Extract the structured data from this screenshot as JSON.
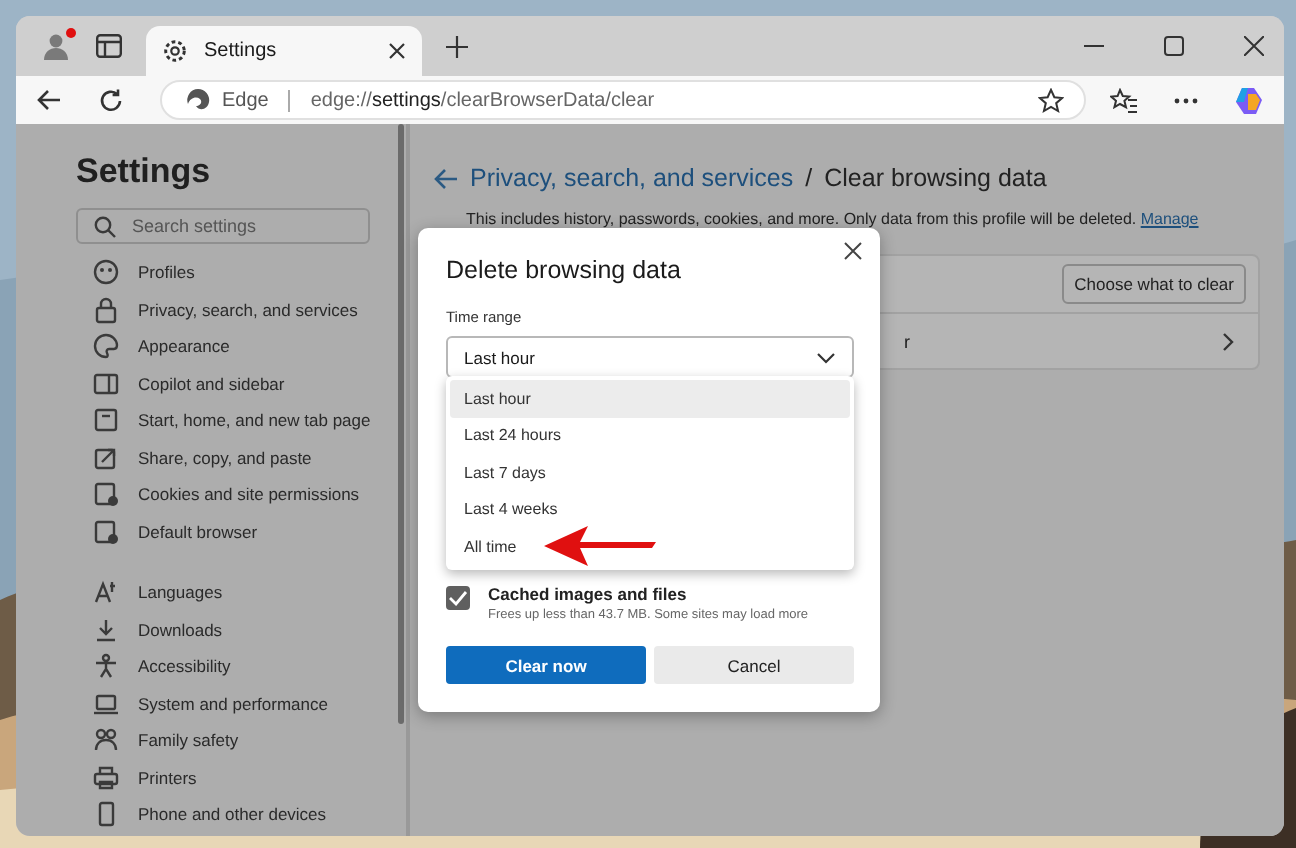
{
  "browser": {
    "tab": {
      "title": "Settings"
    },
    "address": {
      "site": "Edge",
      "url_prefix": "edge://",
      "url_bold": "settings",
      "url_rest": "/clearBrowserData/clear"
    },
    "profile_notification": true
  },
  "sidebar": {
    "title": "Settings",
    "search": {
      "placeholder": "Search settings"
    },
    "groups": [
      [
        {
          "label": "Profiles",
          "kind": "profile"
        },
        {
          "label": "Privacy, search, and services",
          "kind": "lock"
        },
        {
          "label": "Appearance",
          "kind": "palette"
        },
        {
          "label": "Copilot and sidebar",
          "kind": "sidebar"
        },
        {
          "label": "Start, home, and new tab page",
          "kind": "home"
        },
        {
          "label": "Share, copy, and paste",
          "kind": "share"
        },
        {
          "label": "Cookies and site permissions",
          "kind": "cookies"
        },
        {
          "label": "Default browser",
          "kind": "browser"
        }
      ],
      [
        {
          "label": "Languages",
          "kind": "language"
        },
        {
          "label": "Downloads",
          "kind": "download"
        },
        {
          "label": "Accessibility",
          "kind": "accessibility"
        },
        {
          "label": "System and performance",
          "kind": "laptop"
        },
        {
          "label": "Family safety",
          "kind": "family"
        },
        {
          "label": "Printers",
          "kind": "printer"
        },
        {
          "label": "Phone and other devices",
          "kind": "phone"
        }
      ]
    ]
  },
  "main": {
    "breadcrumb": {
      "parent": "Privacy, search, and services",
      "separator": "/",
      "current": "Clear browsing data"
    },
    "description": "This includes history, passwords, cookies, and more. Only data from this profile will be deleted.",
    "description_link": "Manage",
    "card": {
      "button": "Choose what to clear",
      "row_text": "r"
    }
  },
  "dialog": {
    "title": "Delete browsing data",
    "field_label": "Time range",
    "value": "Last hour",
    "options": [
      {
        "label": "Last hour",
        "selected": true
      },
      {
        "label": "Last 24 hours",
        "selected": false
      },
      {
        "label": "Last 7 days",
        "selected": false
      },
      {
        "label": "Last 4 weeks",
        "selected": false
      },
      {
        "label": "All time",
        "selected": false
      }
    ],
    "checkbox": {
      "label": "Cached images and files",
      "description": "Frees up less than 43.7 MB. Some sites may load more",
      "checked": true
    },
    "primary_button": "Clear now",
    "secondary_button": "Cancel"
  }
}
